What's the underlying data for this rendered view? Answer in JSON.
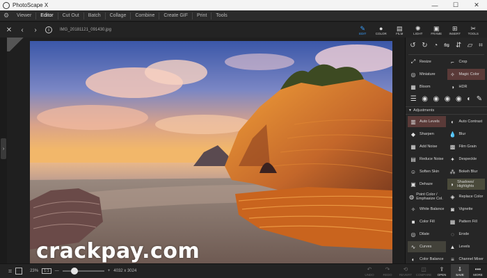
{
  "window": {
    "title": "PhotoScape X",
    "minimize": "—",
    "maximize": "☐",
    "close": "✕"
  },
  "menu": {
    "settings_icon": "gear-icon",
    "items": [
      "Viewer",
      "Editor",
      "Cut Out",
      "Batch",
      "Collage",
      "Combine",
      "Create GIF",
      "Print",
      "Tools"
    ],
    "active": "Editor"
  },
  "toolbar": {
    "filename": "IMG_20181121_091430.jpg",
    "mode_tabs": [
      "EDIT",
      "COLOR",
      "FILM",
      "LIGHT",
      "FRAME",
      "INSERT",
      "TOOLS"
    ],
    "active_mode": "EDIT"
  },
  "watermark": "crackpay.com",
  "panel": {
    "top_tools": [
      {
        "label": "Resize",
        "icon": "resize-icon"
      },
      {
        "label": "Crop",
        "icon": "crop-icon"
      },
      {
        "label": "Miniature",
        "icon": "miniature-icon"
      },
      {
        "label": "Magic Color",
        "icon": "magic-color-icon"
      },
      {
        "label": "Bloom",
        "icon": "bloom-icon"
      },
      {
        "label": "HDR",
        "icon": "hdr-icon"
      }
    ],
    "section": "Adjustments",
    "adjust_tools": [
      {
        "label": "Auto Levels",
        "icon": "auto-levels-icon"
      },
      {
        "label": "Auto Contrast",
        "icon": "auto-contrast-icon"
      },
      {
        "label": "Sharpen",
        "icon": "sharpen-icon"
      },
      {
        "label": "Blur",
        "icon": "blur-icon"
      },
      {
        "label": "Add Noise",
        "icon": "add-noise-icon"
      },
      {
        "label": "Film Grain",
        "icon": "film-grain-icon"
      },
      {
        "label": "Reduce Noise",
        "icon": "reduce-noise-icon"
      },
      {
        "label": "Despeckle",
        "icon": "despeckle-icon"
      },
      {
        "label": "Soften Skin",
        "icon": "soften-skin-icon"
      },
      {
        "label": "Bokeh Blur",
        "icon": "bokeh-blur-icon"
      },
      {
        "label": "Dehaze",
        "icon": "dehaze-icon"
      },
      {
        "label": "Shadows/ Highlights",
        "icon": "shadows-highlights-icon"
      },
      {
        "label": "Point Color / Emphasize Col.",
        "icon": "point-color-icon"
      },
      {
        "label": "Replace Color",
        "icon": "replace-color-icon"
      },
      {
        "label": "White Balance",
        "icon": "white-balance-icon"
      },
      {
        "label": "Vignette",
        "icon": "vignette-icon"
      },
      {
        "label": "Color Fill",
        "icon": "color-fill-icon"
      },
      {
        "label": "Pattern Fill",
        "icon": "pattern-fill-icon"
      },
      {
        "label": "Dilate",
        "icon": "dilate-icon"
      },
      {
        "label": "Erode",
        "icon": "erode-icon"
      },
      {
        "label": "Curves",
        "icon": "curves-icon"
      },
      {
        "label": "Levels",
        "icon": "levels-icon"
      },
      {
        "label": "Color Balance",
        "icon": "color-balance-icon"
      },
      {
        "label": "Channel Mixer",
        "icon": "channel-mixer-icon"
      }
    ]
  },
  "bottom": {
    "zoom": "23%",
    "ratio": "1:1",
    "dimensions": "4032 x 3024",
    "buttons": [
      "UNDO",
      "REDO",
      "REVERT",
      "COMPARE",
      "OPEN",
      "SAVE",
      "MORE"
    ]
  },
  "colors": {
    "accent": "#3aa0ff",
    "panel": "#262626",
    "highlight": "#5a3a38"
  }
}
